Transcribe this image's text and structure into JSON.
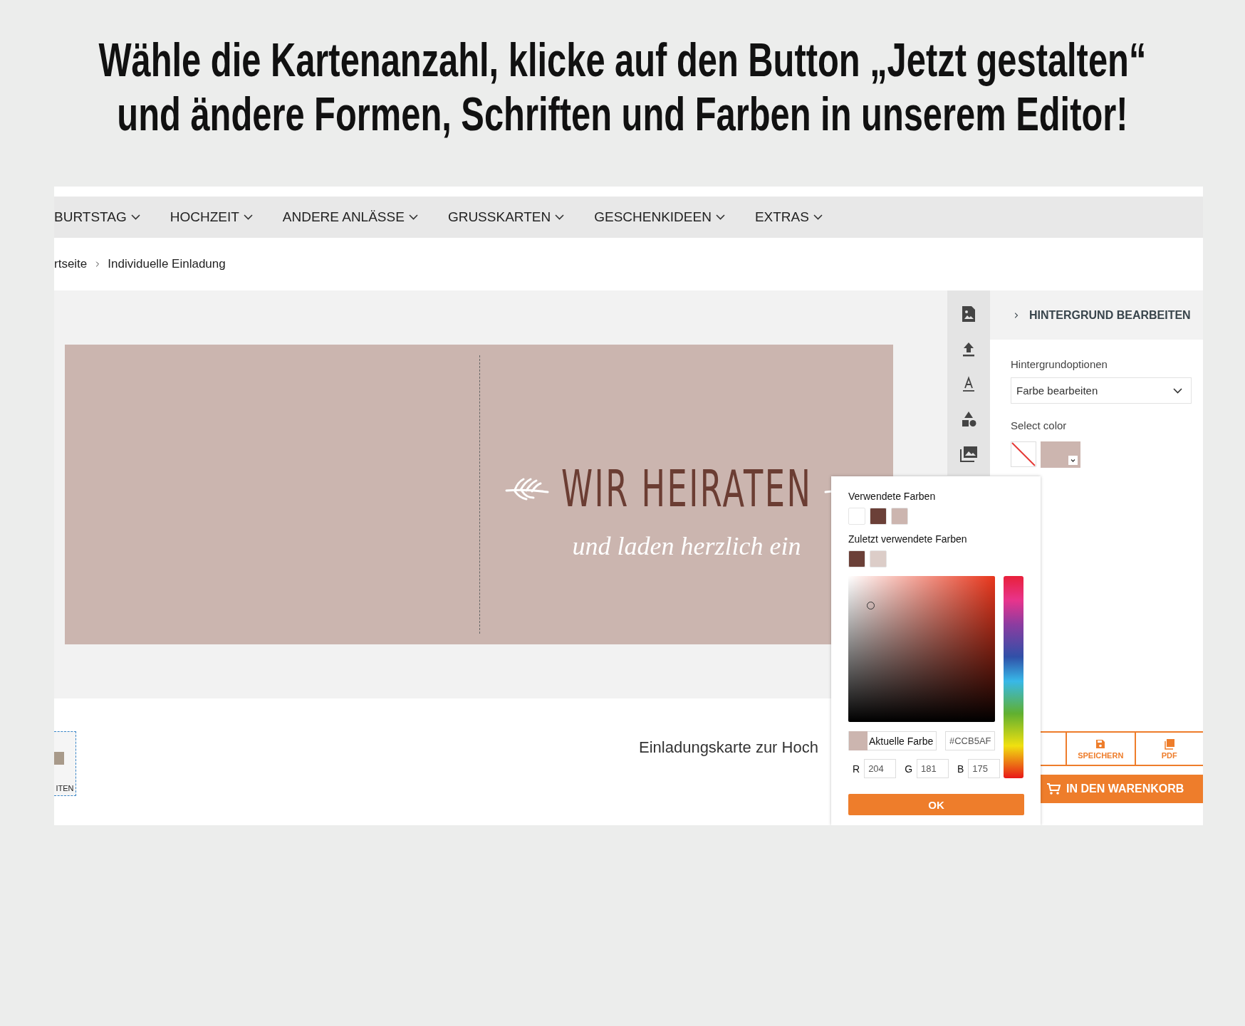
{
  "headline": {
    "lines": [
      "Wähle die Kartenanzahl, klicke auf den Button „Jetzt gestalten“",
      "und ändere Formen, Schriften und Farben in unserem Editor!"
    ]
  },
  "nav": {
    "items": [
      {
        "label": "BURTSTAG"
      },
      {
        "label": "HOCHZEIT"
      },
      {
        "label": "ANDERE ANLÄSSE"
      },
      {
        "label": "GRUSSKARTEN"
      },
      {
        "label": "GESCHENKIDEEN"
      },
      {
        "label": "EXTRAS"
      }
    ]
  },
  "breadcrumb": [
    {
      "label": "rtseite"
    },
    {
      "label": "Individuelle Einladung"
    }
  ],
  "card": {
    "title": "WIR HEIRATEN",
    "subtitle": "und laden herzlich ein",
    "color": "#cbb5af"
  },
  "panel": {
    "header": "HINTERGRUND BEARBEITEN",
    "options_label": "Hintergrundoptionen",
    "select_value": "Farbe bearbeiten",
    "color_label": "Select color",
    "swatches": [
      {
        "kind": "none"
      },
      {
        "kind": "color",
        "color": "#ccb5af"
      }
    ]
  },
  "picker": {
    "used_label": "Verwendete Farben",
    "used_colors": [
      {
        "color": "#ffffff"
      },
      {
        "color": "#6b4038"
      },
      {
        "color": "#ccb5af"
      }
    ],
    "recent_label": "Zuletzt verwendete Farben",
    "recent_colors": [
      {
        "color": "#6b4038"
      },
      {
        "color": "#dccdc8"
      }
    ],
    "current_label": "Aktuelle Farbe",
    "hex": "#CCB5AF",
    "rgb": [
      {
        "label": "R",
        "value": "204"
      },
      {
        "label": "G",
        "value": "181"
      },
      {
        "label": "B",
        "value": "175"
      }
    ],
    "ok": "OK"
  },
  "bottom": {
    "thumb_label": "ITEN",
    "product_title": "Einladungskarte zur Hoch",
    "actions": [
      {
        "kind": "save",
        "label": "SPEICHERN"
      },
      {
        "kind": "pdf",
        "label": "PDF"
      }
    ],
    "cart": "IN DEN WARENKORB"
  }
}
